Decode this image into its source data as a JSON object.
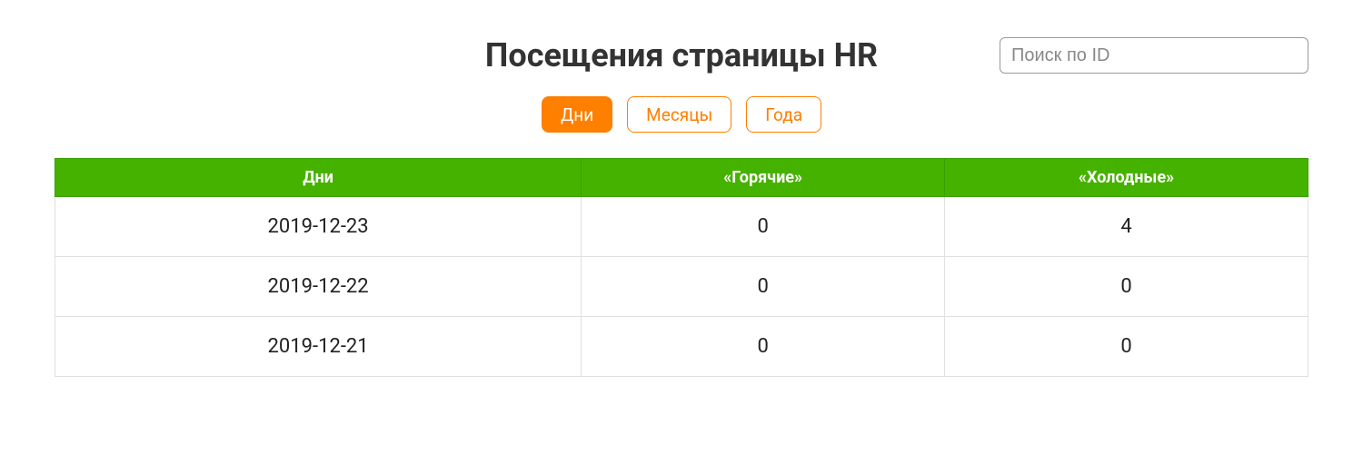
{
  "title": "Посещения страницы HR",
  "search": {
    "placeholder": "Поиск по ID",
    "value": ""
  },
  "tabs": [
    {
      "label": "Дни",
      "active": true
    },
    {
      "label": "Месяцы",
      "active": false
    },
    {
      "label": "Года",
      "active": false
    }
  ],
  "table": {
    "headers": [
      "Дни",
      "«Горячие»",
      "«Холодные»"
    ],
    "rows": [
      {
        "date": "2019-12-23",
        "hot": "0",
        "cold": "4"
      },
      {
        "date": "2019-12-22",
        "hot": "0",
        "cold": "0"
      },
      {
        "date": "2019-12-21",
        "hot": "0",
        "cold": "0"
      }
    ]
  }
}
